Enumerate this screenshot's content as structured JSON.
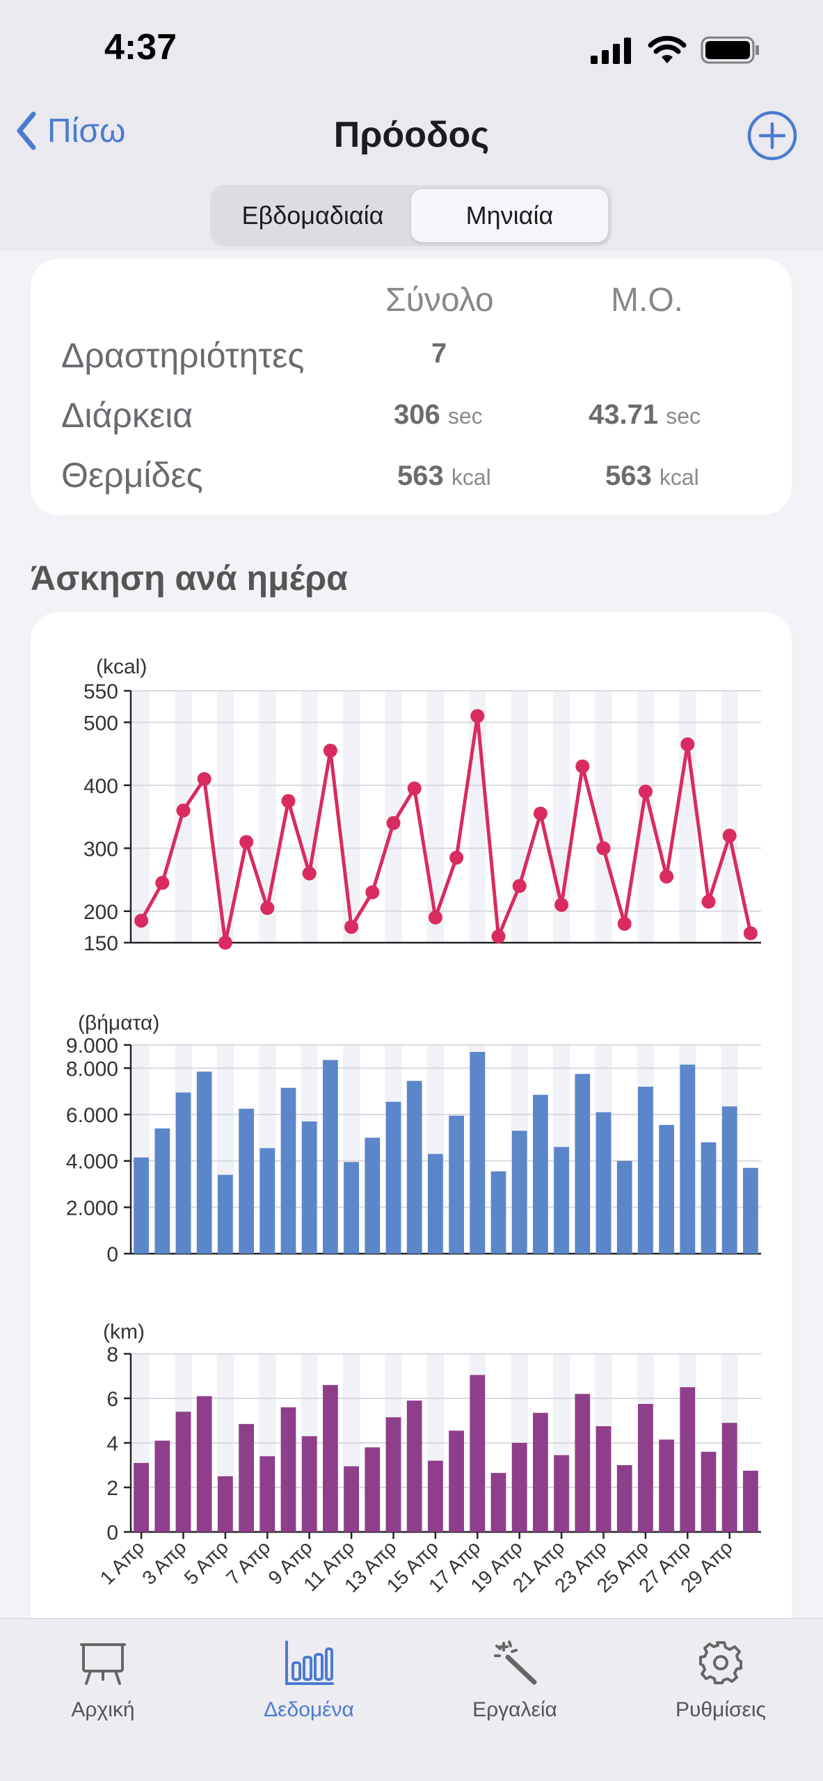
{
  "status_bar": {
    "time": "4:37"
  },
  "nav": {
    "back_label": "Πίσω",
    "title": "Πρόοδος"
  },
  "segments": [
    {
      "label": "Εβδομαδιαία",
      "active": false
    },
    {
      "label": "Μηνιαία",
      "active": true
    }
  ],
  "summary": {
    "col_total": "Σύνολο",
    "col_avg": "Μ.Ο.",
    "rows": [
      {
        "label": "Δραστηριότητες",
        "total": "7",
        "total_unit": "",
        "avg": "",
        "avg_unit": ""
      },
      {
        "label": "Διάρκεια",
        "total": "306",
        "total_unit": "sec",
        "avg": "43.71",
        "avg_unit": "sec"
      },
      {
        "label": "Θερμίδες",
        "total": "563",
        "total_unit": "kcal",
        "avg": "563",
        "avg_unit": "kcal"
      }
    ]
  },
  "section_title": "Άσκηση ανά ημέρα",
  "colors": {
    "accent": "#4b7bd0",
    "kcal_line": "#d92b60",
    "steps_bar": "#5b86c9",
    "km_bar": "#8e3e8a"
  },
  "chart_data": [
    {
      "type": "line",
      "unit_label": "(kcal)",
      "x": [
        "1 Απρ",
        "2 Απρ",
        "3 Απρ",
        "4 Απρ",
        "5 Απρ",
        "6 Απρ",
        "7 Απρ",
        "8 Απρ",
        "9 Απρ",
        "10 Απρ",
        "11 Απρ",
        "12 Απρ",
        "13 Απρ",
        "14 Απρ",
        "15 Απρ",
        "16 Απρ",
        "17 Απρ",
        "18 Απρ",
        "19 Απρ",
        "20 Απρ",
        "21 Απρ",
        "22 Απρ",
        "23 Απρ",
        "24 Απρ",
        "25 Απρ",
        "26 Απρ",
        "27 Απρ",
        "28 Απρ",
        "29 Απρ",
        "30 Απρ"
      ],
      "values": [
        185,
        245,
        360,
        410,
        150,
        310,
        205,
        375,
        260,
        455,
        175,
        230,
        340,
        395,
        190,
        285,
        510,
        160,
        240,
        355,
        210,
        430,
        300,
        180,
        390,
        255,
        465,
        215,
        320,
        165
      ],
      "ylim": [
        150,
        550
      ],
      "yticks": [
        150,
        200,
        300,
        400,
        500,
        550
      ],
      "ytick_labels": [
        "150",
        "200",
        "300",
        "400",
        "500",
        "550"
      ]
    },
    {
      "type": "bar",
      "unit_label": "(βήματα)",
      "x": [
        "1 Απρ",
        "2 Απρ",
        "3 Απρ",
        "4 Απρ",
        "5 Απρ",
        "6 Απρ",
        "7 Απρ",
        "8 Απρ",
        "9 Απρ",
        "10 Απρ",
        "11 Απρ",
        "12 Απρ",
        "13 Απρ",
        "14 Απρ",
        "15 Απρ",
        "16 Απρ",
        "17 Απρ",
        "18 Απρ",
        "19 Απρ",
        "20 Απρ",
        "21 Απρ",
        "22 Απρ",
        "23 Απρ",
        "24 Απρ",
        "25 Απρ",
        "26 Απρ",
        "27 Απρ",
        "28 Απρ",
        "29 Απρ",
        "30 Απρ"
      ],
      "values": [
        4150,
        5400,
        6950,
        7850,
        3400,
        6250,
        4550,
        7150,
        5700,
        8350,
        3950,
        5000,
        6550,
        7450,
        4300,
        5950,
        8700,
        3550,
        5300,
        6850,
        4600,
        7750,
        6100,
        4000,
        7200,
        5550,
        8150,
        4800,
        6350,
        3700
      ],
      "ylim": [
        0,
        9000
      ],
      "yticks": [
        0,
        2000,
        4000,
        6000,
        8000,
        9000
      ],
      "ytick_labels": [
        "0",
        "2.000",
        "4.000",
        "6.000",
        "8.000",
        "9.000"
      ]
    },
    {
      "type": "bar",
      "unit_label": "(km)",
      "x": [
        "1 Απρ",
        "2 Απρ",
        "3 Απρ",
        "4 Απρ",
        "5 Απρ",
        "6 Απρ",
        "7 Απρ",
        "8 Απρ",
        "9 Απρ",
        "10 Απρ",
        "11 Απρ",
        "12 Απρ",
        "13 Απρ",
        "14 Απρ",
        "15 Απρ",
        "16 Απρ",
        "17 Απρ",
        "18 Απρ",
        "19 Απρ",
        "20 Απρ",
        "21 Απρ",
        "22 Απρ",
        "23 Απρ",
        "24 Απρ",
        "25 Απρ",
        "26 Απρ",
        "27 Απρ",
        "28 Απρ",
        "29 Απρ",
        "30 Απρ"
      ],
      "values": [
        3.1,
        4.1,
        5.4,
        6.1,
        2.5,
        4.85,
        3.4,
        5.6,
        4.3,
        6.6,
        2.95,
        3.8,
        5.15,
        5.9,
        3.2,
        4.55,
        7.05,
        2.65,
        4.0,
        5.35,
        3.45,
        6.2,
        4.75,
        3.0,
        5.75,
        4.15,
        6.5,
        3.6,
        4.9,
        2.75
      ],
      "ylim": [
        0,
        8
      ],
      "yticks": [
        0,
        2,
        4,
        6,
        8
      ],
      "ytick_labels": [
        "0",
        "2",
        "4",
        "6",
        "8"
      ],
      "xtick_labels": [
        "1 Απρ",
        "3 Απρ",
        "5 Απρ",
        "7 Απρ",
        "9 Απρ",
        "11 Απρ",
        "13 Απρ",
        "15 Απρ",
        "17 Απρ",
        "19 Απρ",
        "21 Απρ",
        "23 Απρ",
        "25 Απρ",
        "27 Απρ",
        "29 Απρ"
      ]
    }
  ],
  "tabs": [
    {
      "label": "Αρχική",
      "icon": "easel-icon",
      "active": false
    },
    {
      "label": "Δεδομένα",
      "icon": "bar-chart-icon",
      "active": true
    },
    {
      "label": "Εργαλεία",
      "icon": "magic-wand-icon",
      "active": false
    },
    {
      "label": "Ρυθμίσεις",
      "icon": "gear-icon",
      "active": false
    }
  ]
}
